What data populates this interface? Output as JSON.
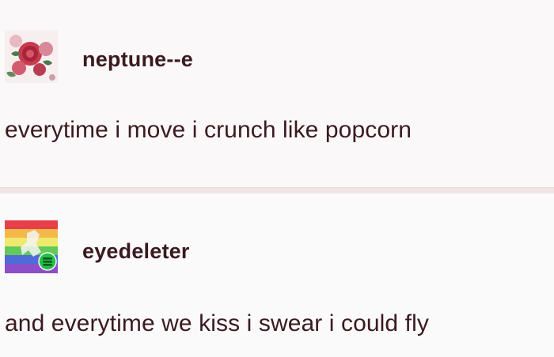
{
  "posts": [
    {
      "username": "neptune--e",
      "text": "everytime i move i crunch like popcorn",
      "avatar_icon": "rose-avatar-icon"
    },
    {
      "username": "eyedeleter",
      "text": "and everytime we kiss i swear i could fly",
      "avatar_icon": "rainbow-avatar-icon",
      "badge_icon": "green-badge-icon"
    }
  ],
  "colors": {
    "text": "#3a1a20",
    "background": "#faf8f8",
    "divider": "#f1e6e7",
    "badge": "#22c046"
  }
}
